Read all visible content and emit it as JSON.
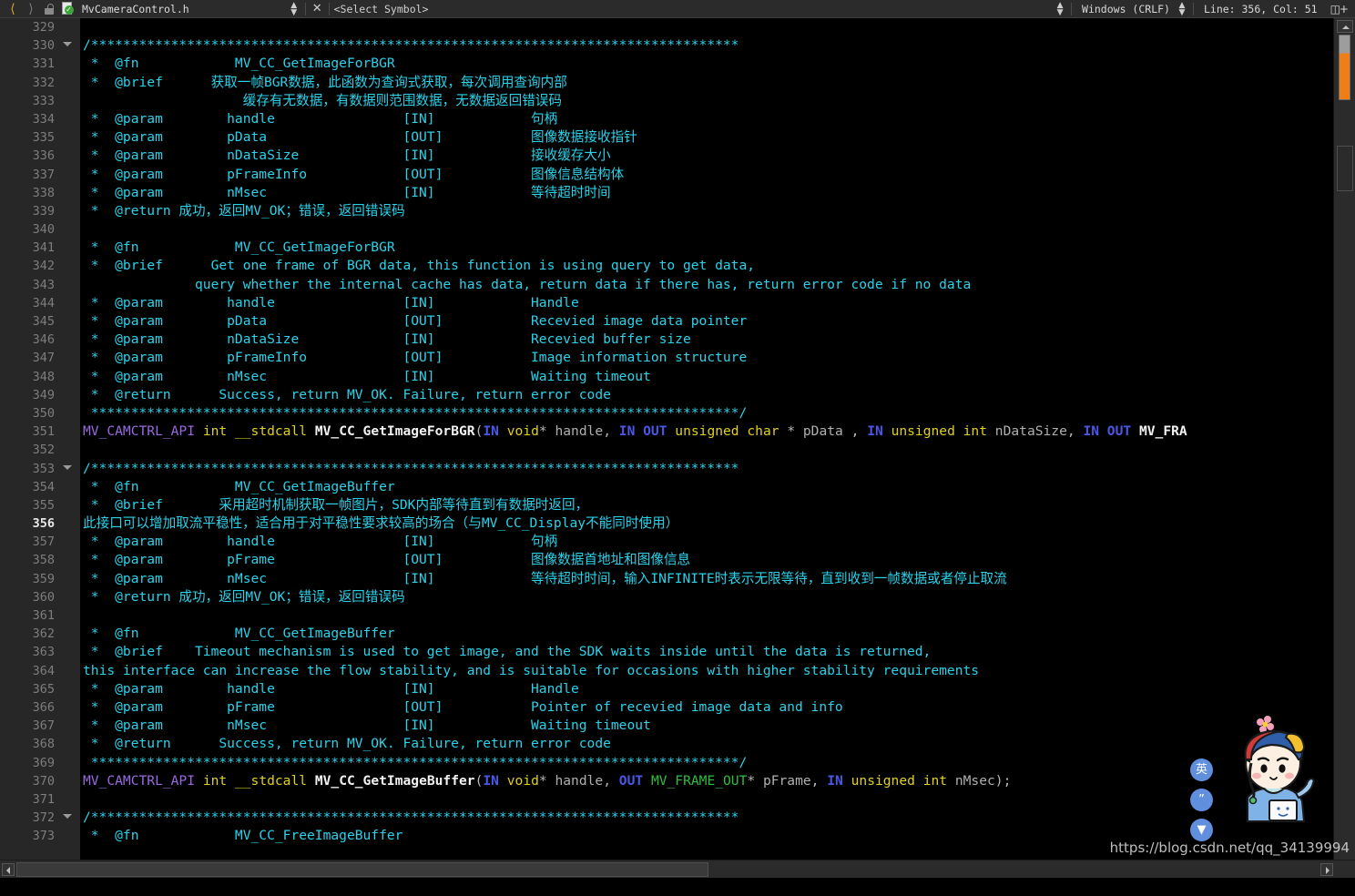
{
  "toolbar": {
    "back_icon": "chevron-left-icon",
    "forward_icon": "chevron-right-icon",
    "lock_icon": "unlocked-padlock-icon",
    "file_status_icon": "file-checked-icon",
    "file_name": "MvCameraControl.h",
    "close_label": "✕",
    "select_symbol": "<Select Symbol>",
    "line_ending": "Windows (CRLF)",
    "caret_position": "Line: 356, Col: 51",
    "split_view_icon": "split-editor-icon"
  },
  "editor": {
    "current_line": 356,
    "first_line": 329,
    "fold_lines": [
      330,
      353,
      372
    ],
    "colors": {
      "background": "#000000",
      "gutter": "#272727",
      "comment": "#2ad2ea",
      "macro": "#9a6ae0",
      "keyword": "#e0d020",
      "function": "#f2f2f2",
      "in_out": "#4a58e8",
      "type": "#2fbd3f",
      "identifier": "#b0b0b0",
      "scrollbar_marker": "#ef7d18"
    },
    "stars_long": "/*********************************************************************************",
    "stars_close": " *********************************************************************************/",
    "lines": [
      {
        "n": 329,
        "tokens": []
      },
      {
        "n": 330,
        "fold": true,
        "tokens": [
          {
            "t": "/*********************************************************************************",
            "c": "cmt"
          }
        ]
      },
      {
        "n": 331,
        "tokens": [
          {
            "t": " *  @fn            MV_CC_GetImageForBGR",
            "c": "cmt"
          }
        ]
      },
      {
        "n": 332,
        "tokens": [
          {
            "t": " *  @brief      获取一帧BGR数据，此函数为查询式获取，每次调用查询内部",
            "c": "cmt"
          }
        ]
      },
      {
        "n": 333,
        "tokens": [
          {
            "t": "                    缓存有无数据，有数据则范围数据，无数据返回错误码",
            "c": "cmt"
          }
        ]
      },
      {
        "n": 334,
        "tokens": [
          {
            "t": " *  @param        handle                [IN]            句柄",
            "c": "cmt"
          }
        ]
      },
      {
        "n": 335,
        "tokens": [
          {
            "t": " *  @param        pData                 [OUT]           图像数据接收指针",
            "c": "cmt"
          }
        ]
      },
      {
        "n": 336,
        "tokens": [
          {
            "t": " *  @param        nDataSize             [IN]            接收缓存大小",
            "c": "cmt"
          }
        ]
      },
      {
        "n": 337,
        "tokens": [
          {
            "t": " *  @param        pFrameInfo            [OUT]           图像信息结构体",
            "c": "cmt"
          }
        ]
      },
      {
        "n": 338,
        "tokens": [
          {
            "t": " *  @param        nMsec                 [IN]            等待超时时间",
            "c": "cmt"
          }
        ]
      },
      {
        "n": 339,
        "tokens": [
          {
            "t": " *  @return 成功，返回MV_OK；错误，返回错误码",
            "c": "cmt"
          }
        ]
      },
      {
        "n": 340,
        "tokens": []
      },
      {
        "n": 341,
        "tokens": [
          {
            "t": " *  @fn            MV_CC_GetImageForBGR",
            "c": "cmt"
          }
        ]
      },
      {
        "n": 342,
        "tokens": [
          {
            "t": " *  @brief      Get one frame of BGR data, this function is using query to get data,",
            "c": "cmt"
          }
        ]
      },
      {
        "n": 343,
        "tokens": [
          {
            "t": "              query whether the internal cache has data, return data if there has, return error code if no data",
            "c": "cmt"
          }
        ]
      },
      {
        "n": 344,
        "tokens": [
          {
            "t": " *  @param        handle                [IN]            Handle",
            "c": "cmt"
          }
        ]
      },
      {
        "n": 345,
        "tokens": [
          {
            "t": " *  @param        pData                 [OUT]           Recevied image data pointer",
            "c": "cmt"
          }
        ]
      },
      {
        "n": 346,
        "tokens": [
          {
            "t": " *  @param        nDataSize             [IN]            Recevied buffer size",
            "c": "cmt"
          }
        ]
      },
      {
        "n": 347,
        "tokens": [
          {
            "t": " *  @param        pFrameInfo            [OUT]           Image information structure",
            "c": "cmt"
          }
        ]
      },
      {
        "n": 348,
        "tokens": [
          {
            "t": " *  @param        nMsec                 [IN]            Waiting timeout",
            "c": "cmt"
          }
        ]
      },
      {
        "n": 349,
        "tokens": [
          {
            "t": " *  @return      Success, return MV_OK. Failure, return error code",
            "c": "cmt"
          }
        ]
      },
      {
        "n": 350,
        "tokens": [
          {
            "t": " *********************************************************************************/",
            "c": "cmt"
          }
        ]
      },
      {
        "n": 351,
        "tokens": [
          {
            "t": "MV_CAMCTRL_API",
            "c": "macro"
          },
          {
            "t": " ",
            "c": "punct"
          },
          {
            "t": "int",
            "c": "kw"
          },
          {
            "t": " ",
            "c": "punct"
          },
          {
            "t": "__stdcall",
            "c": "kw"
          },
          {
            "t": " ",
            "c": "punct"
          },
          {
            "t": "MV_CC_GetImageForBGR",
            "c": "fn"
          },
          {
            "t": "(",
            "c": "punct"
          },
          {
            "t": "IN",
            "c": "inout"
          },
          {
            "t": " ",
            "c": "punct"
          },
          {
            "t": "void",
            "c": "kw"
          },
          {
            "t": "* ",
            "c": "punct"
          },
          {
            "t": "handle",
            "c": "ident"
          },
          {
            "t": ", ",
            "c": "punct"
          },
          {
            "t": "IN OUT",
            "c": "inout"
          },
          {
            "t": " ",
            "c": "punct"
          },
          {
            "t": "unsigned char",
            "c": "kw"
          },
          {
            "t": " * ",
            "c": "punct"
          },
          {
            "t": "pData",
            "c": "ident"
          },
          {
            "t": " , ",
            "c": "punct"
          },
          {
            "t": "IN",
            "c": "inout"
          },
          {
            "t": " ",
            "c": "punct"
          },
          {
            "t": "unsigned int",
            "c": "kw"
          },
          {
            "t": " ",
            "c": "punct"
          },
          {
            "t": "nDataSize",
            "c": "ident"
          },
          {
            "t": ", ",
            "c": "punct"
          },
          {
            "t": "IN OUT",
            "c": "inout"
          },
          {
            "t": " ",
            "c": "punct"
          },
          {
            "t": "MV_FRA",
            "c": "fn"
          }
        ]
      },
      {
        "n": 352,
        "tokens": []
      },
      {
        "n": 353,
        "fold": true,
        "tokens": [
          {
            "t": "/*********************************************************************************",
            "c": "cmt"
          }
        ]
      },
      {
        "n": 354,
        "tokens": [
          {
            "t": " *  @fn            MV_CC_GetImageBuffer",
            "c": "cmt"
          }
        ]
      },
      {
        "n": 355,
        "tokens": [
          {
            "t": " *  @brief       采用超时机制获取一帧图片，SDK内部等待直到有数据时返回，",
            "c": "cmt"
          }
        ]
      },
      {
        "n": 356,
        "current": true,
        "tokens": [
          {
            "t": "此接口可以增加取流平稳性，适合用于对平稳性要求较高的场合（与MV_CC_Display不能同时使用）",
            "c": "cmt"
          }
        ]
      },
      {
        "n": 357,
        "tokens": [
          {
            "t": " *  @param        handle                [IN]            句柄",
            "c": "cmt"
          }
        ]
      },
      {
        "n": 358,
        "tokens": [
          {
            "t": " *  @param        pFrame                [OUT]           图像数据首地址和图像信息",
            "c": "cmt"
          }
        ]
      },
      {
        "n": 359,
        "tokens": [
          {
            "t": " *  @param        nMsec                 [IN]            等待超时时间，输入INFINITE时表示无限等待，直到收到一帧数据或者停止取流",
            "c": "cmt"
          }
        ]
      },
      {
        "n": 360,
        "tokens": [
          {
            "t": " *  @return 成功，返回MV_OK；错误，返回错误码",
            "c": "cmt"
          }
        ]
      },
      {
        "n": 361,
        "tokens": []
      },
      {
        "n": 362,
        "tokens": [
          {
            "t": " *  @fn            MV_CC_GetImageBuffer",
            "c": "cmt"
          }
        ]
      },
      {
        "n": 363,
        "tokens": [
          {
            "t": " *  @brief    Timeout mechanism is used to get image, and the SDK waits inside until the data is returned,",
            "c": "cmt"
          }
        ]
      },
      {
        "n": 364,
        "tokens": [
          {
            "t": "this interface can increase the flow stability, and is suitable for occasions with higher stability requirements",
            "c": "cmt"
          }
        ]
      },
      {
        "n": 365,
        "tokens": [
          {
            "t": " *  @param        handle                [IN]            Handle",
            "c": "cmt"
          }
        ]
      },
      {
        "n": 366,
        "tokens": [
          {
            "t": " *  @param        pFrame                [OUT]           Pointer of recevied image data and info",
            "c": "cmt"
          }
        ]
      },
      {
        "n": 367,
        "tokens": [
          {
            "t": " *  @param        nMsec                 [IN]            Waiting timeout",
            "c": "cmt"
          }
        ]
      },
      {
        "n": 368,
        "tokens": [
          {
            "t": " *  @return      Success, return MV_OK. Failure, return error code",
            "c": "cmt"
          }
        ]
      },
      {
        "n": 369,
        "tokens": [
          {
            "t": " *********************************************************************************/",
            "c": "cmt"
          }
        ]
      },
      {
        "n": 370,
        "tokens": [
          {
            "t": "MV_CAMCTRL_API",
            "c": "macro"
          },
          {
            "t": " ",
            "c": "punct"
          },
          {
            "t": "int",
            "c": "kw"
          },
          {
            "t": " ",
            "c": "punct"
          },
          {
            "t": "__stdcall",
            "c": "kw"
          },
          {
            "t": " ",
            "c": "punct"
          },
          {
            "t": "MV_CC_GetImageBuffer",
            "c": "fn"
          },
          {
            "t": "(",
            "c": "punct"
          },
          {
            "t": "IN",
            "c": "inout"
          },
          {
            "t": " ",
            "c": "punct"
          },
          {
            "t": "void",
            "c": "kw"
          },
          {
            "t": "* ",
            "c": "punct"
          },
          {
            "t": "handle",
            "c": "ident"
          },
          {
            "t": ", ",
            "c": "punct"
          },
          {
            "t": "OUT",
            "c": "inout"
          },
          {
            "t": " ",
            "c": "punct"
          },
          {
            "t": "MV_FRAME_OUT",
            "c": "type"
          },
          {
            "t": "* ",
            "c": "punct"
          },
          {
            "t": "pFrame",
            "c": "ident"
          },
          {
            "t": ", ",
            "c": "punct"
          },
          {
            "t": "IN",
            "c": "inout"
          },
          {
            "t": " ",
            "c": "punct"
          },
          {
            "t": "unsigned int",
            "c": "kw"
          },
          {
            "t": " ",
            "c": "punct"
          },
          {
            "t": "nMsec",
            "c": "ident"
          },
          {
            "t": ");",
            "c": "punct"
          }
        ]
      },
      {
        "n": 371,
        "tokens": []
      },
      {
        "n": 372,
        "fold": true,
        "tokens": [
          {
            "t": "/*********************************************************************************",
            "c": "cmt"
          }
        ]
      },
      {
        "n": 373,
        "tokens": [
          {
            "t": " *  @fn            MV_CC_FreeImageBuffer",
            "c": "cmt"
          }
        ]
      }
    ]
  },
  "overlay": {
    "watermark": "https://blog.csdn.net/qq_34139994",
    "mascot_name": "cartoon-boy-sticker",
    "side_buttons": [
      {
        "label": "英",
        "name": "translate-english-button"
      },
      {
        "label": "”",
        "name": "quote-button"
      },
      {
        "label": "▼",
        "name": "outfit-button"
      }
    ]
  }
}
